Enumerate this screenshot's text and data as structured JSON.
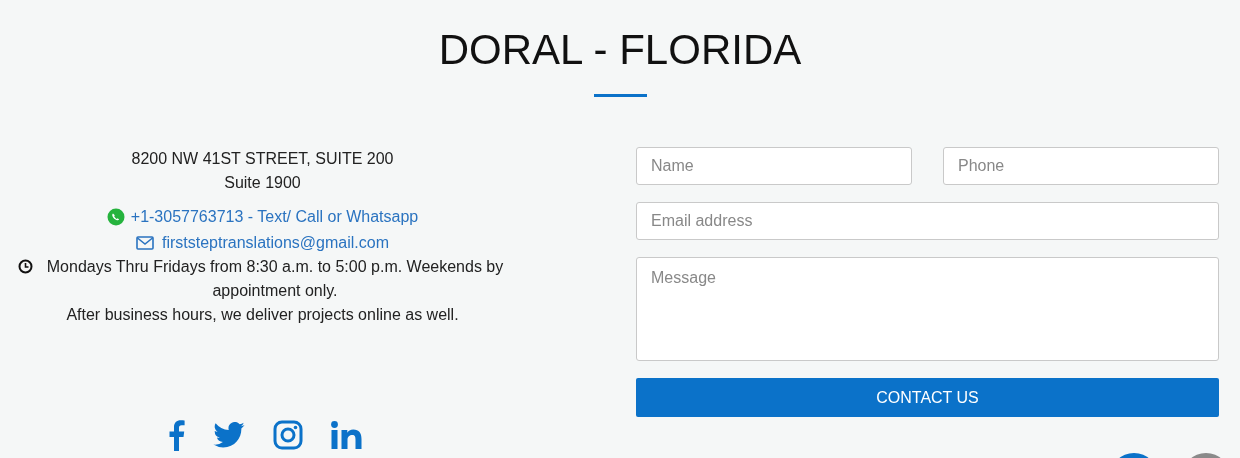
{
  "title": "DORAL - FLORIDA",
  "address": [
    "8200 NW 41ST STREET, SUITE 200",
    "Suite 1900"
  ],
  "phone": "+1-3057763713 - Text/ Call or Whatsapp",
  "email": "firststeptranslations@gmail.com",
  "hours": "Mondays Thru Fridays from 8:30 a.m. to 5:00 p.m. Weekends by appointment only.",
  "note": "After business hours, we deliver projects online as well.",
  "social": [
    {
      "kind": "facebook"
    },
    {
      "kind": "twitter"
    },
    {
      "kind": "instagram"
    },
    {
      "kind": "linkedin"
    }
  ],
  "form": {
    "name": {
      "placeholder": "Name"
    },
    "phone": {
      "placeholder": "Phone"
    },
    "email": {
      "placeholder": "Email address"
    },
    "message": {
      "placeholder": "Message"
    },
    "submit": "CONTACT US"
  }
}
